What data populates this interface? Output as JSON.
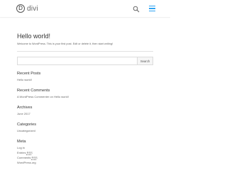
{
  "header": {
    "logo_mark": "D",
    "logo_text": "divi",
    "search_icon": "search-icon",
    "menu_icon": "hamburger-menu-icon",
    "accent_color": "#2ea3f2"
  },
  "post": {
    "title": "Hello world!",
    "excerpt": "Welcome to WordPress. This is your first post. Edit or delete it, then start writing!"
  },
  "search": {
    "placeholder": "",
    "button_label": "Search"
  },
  "widgets": {
    "recent_posts": {
      "title": "Recent Posts",
      "items": [
        "Hello world!"
      ]
    },
    "recent_comments": {
      "title": "Recent Comments",
      "items": [
        "A WordPress Commenter on Hello world!"
      ]
    },
    "archives": {
      "title": "Archives",
      "items": [
        "June 2017"
      ]
    },
    "categories": {
      "title": "Categories",
      "items": [
        "Uncategorized"
      ]
    },
    "meta": {
      "title": "Meta",
      "items": [
        "Log in",
        "Entries",
        "RSS",
        "Comments",
        "RSS",
        "WordPress.org"
      ]
    }
  }
}
